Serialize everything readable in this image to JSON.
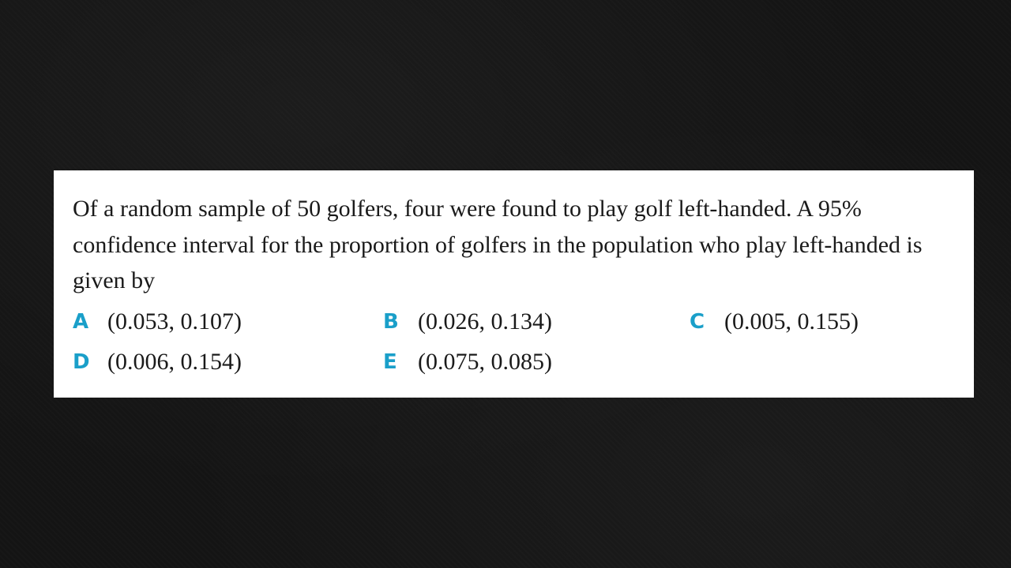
{
  "question": {
    "stem": "Of a random sample of 50 golfers, four were found to play golf left-handed.  A 95% confidence interval for the proportion of golfers in the population who play left-handed is given by"
  },
  "options": [
    {
      "letter": "A",
      "text": "(0.053, 0.107)"
    },
    {
      "letter": "B",
      "text": "(0.026, 0.134)"
    },
    {
      "letter": "C",
      "text": "(0.005, 0.155)"
    },
    {
      "letter": "D",
      "text": "(0.006, 0.154)"
    },
    {
      "letter": "E",
      "text": "(0.075, 0.085)"
    }
  ],
  "colors": {
    "background": "#141414",
    "card": "#ffffff",
    "option_letter": "#1a9fc9",
    "text": "#1a1a1a"
  }
}
